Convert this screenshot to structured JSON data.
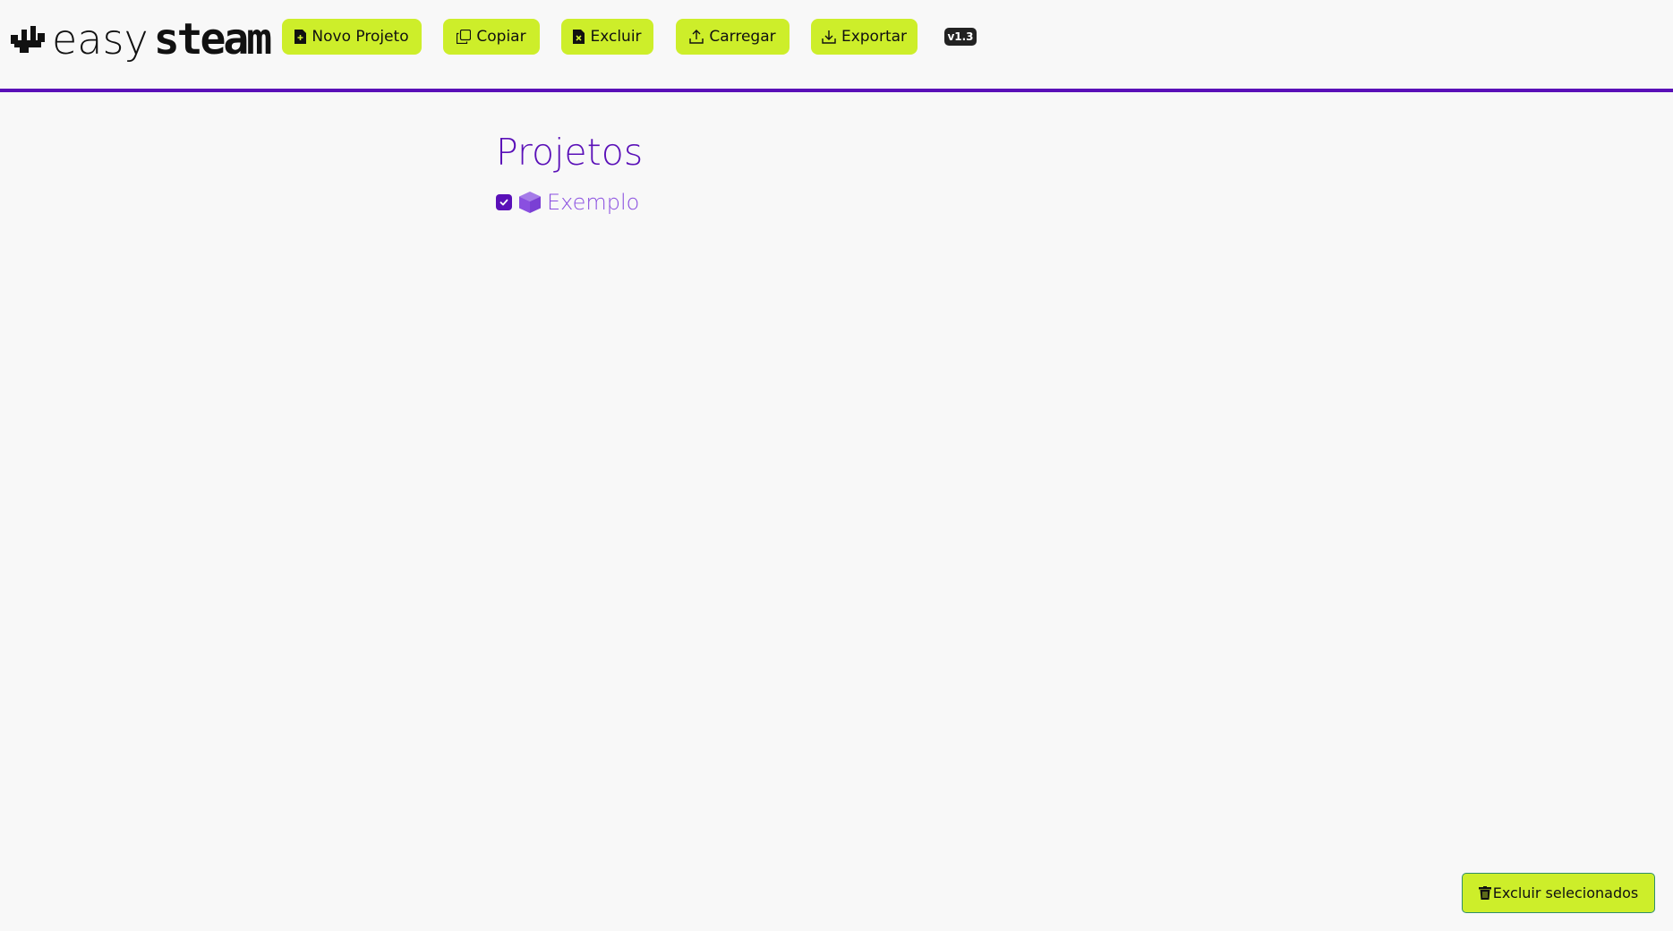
{
  "brand": {
    "name_light": "easy",
    "name_bold": "steam",
    "logo_icon": "easysteam-logo-icon"
  },
  "toolbar": {
    "items": [
      {
        "label": "Novo Projeto",
        "icon": "new-file-icon"
      },
      {
        "label": "Copiar",
        "icon": "copy-icon"
      },
      {
        "label": "Excluir",
        "icon": "delete-file-icon"
      },
      {
        "label": "Carregar",
        "icon": "upload-icon"
      },
      {
        "label": "Exportar",
        "icon": "download-icon"
      }
    ],
    "version": "v1.3"
  },
  "main": {
    "title": "Projetos",
    "projects": [
      {
        "name": "Exemplo",
        "selected": true,
        "icon": "cube-icon"
      }
    ]
  },
  "footer": {
    "delete_selected_label": "Excluir selecionados",
    "delete_selected_icon": "trash-icon"
  },
  "colors": {
    "accent": "#5a10b8",
    "button": "#cdee2a",
    "project_text": "#8a4fe0",
    "background": "#f8f8f8"
  }
}
